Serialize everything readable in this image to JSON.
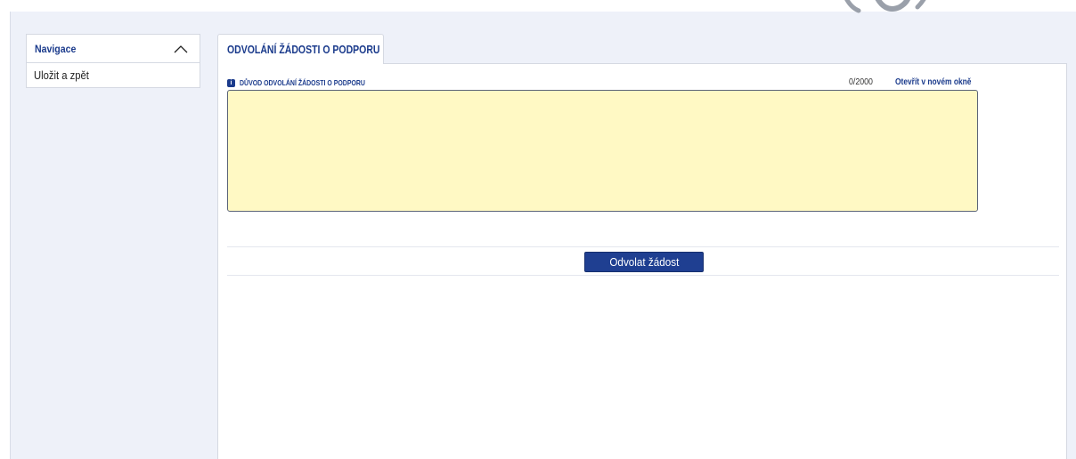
{
  "sidebar": {
    "title": "Navigace",
    "items": [
      {
        "label": "Uložit a zpět"
      }
    ]
  },
  "tab": {
    "label": "ODVOLÁNÍ ŽÁDOSTI O PODPORU"
  },
  "form": {
    "info_icon": "i",
    "field_label": "DŮVOD ODVOLÁNÍ ŽÁDOSTI O PODPORU",
    "char_counter": "0/2000",
    "open_new_window_label": "Otevřít v novém okně",
    "textarea_value": "",
    "submit_label": "Odvolat žádost"
  },
  "colors": {
    "accent": "#1b3b8c",
    "button": "#1f3f91",
    "field_bg": "#fff9c4",
    "page_bg": "#eef1f9"
  },
  "icons": {
    "collapse": "chevron-up-icon",
    "info": "info-icon"
  }
}
